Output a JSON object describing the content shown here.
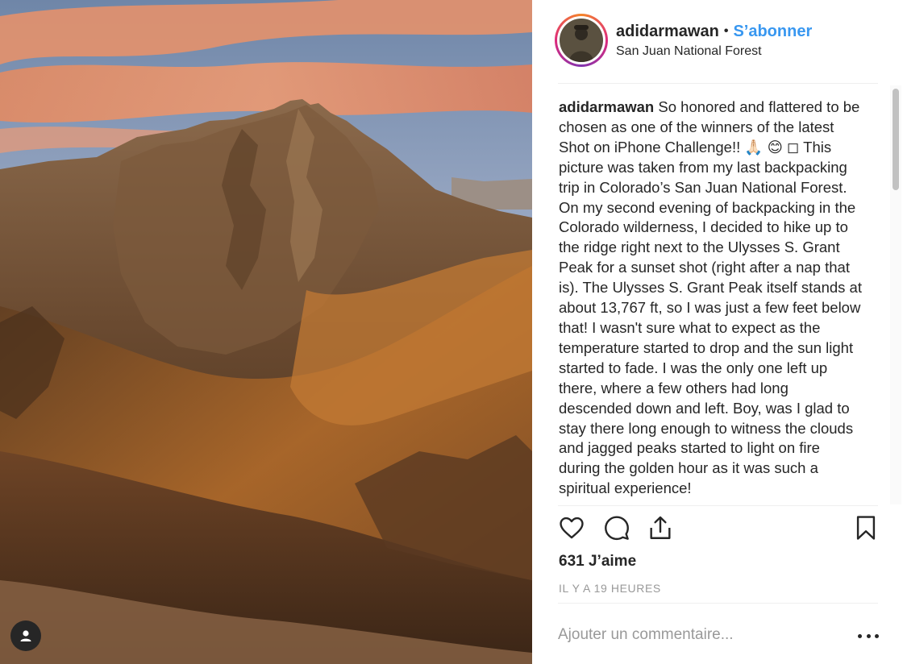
{
  "post": {
    "username": "adidarmawan",
    "separator": "•",
    "follow_label": "S’abonner",
    "location": "San Juan National Forest"
  },
  "caption": {
    "username": "adidarmawan",
    "text": " So honored and flattered to be chosen as one of the winners of the latest Shot on iPhone Challenge!! 🙏🏻 😊 ◻ This picture was taken from my last backpacking trip in Colorado’s San Juan National Forest. On my second evening of backpacking in the Colorado wilderness, I decided to hike up to the ridge right next to the Ulysses S. Grant Peak for a sunset shot (right after a nap that is). The Ulysses S. Grant Peak itself stands at about 13,767 ft, so I was just a few feet below that! I wasn't sure what to expect as the temperature started to drop and the sun light started to fade. I was the only one left up there, where a few others had long descended down and left. Boy, was I glad to stay there long enough to witness the clouds and jagged peaks started to light on fire during the golden hour as it was such a spiritual experience!"
  },
  "stats": {
    "likes": "631 J’aime",
    "time": "IL Y A 19 HEURES"
  },
  "comment": {
    "placeholder": "Ajouter un commentaire..."
  },
  "icons": {
    "like": "heart-icon",
    "comment": "comment-icon",
    "share": "share-icon",
    "save": "bookmark-icon",
    "more": "more-icon",
    "tag": "user-tag-icon"
  },
  "colors": {
    "follow": "#3897f0",
    "text": "#262626",
    "muted": "#999999"
  }
}
